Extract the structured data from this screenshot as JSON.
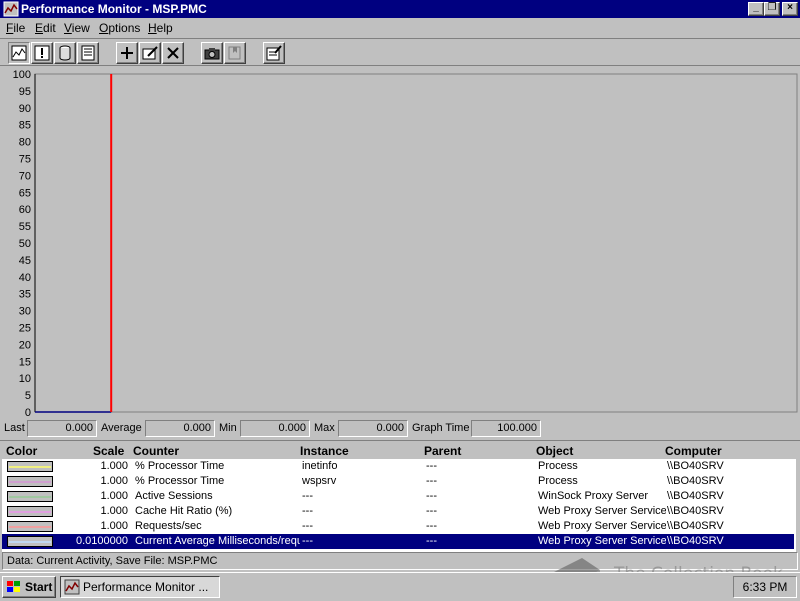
{
  "window": {
    "title": "Performance Monitor - MSP.PMC"
  },
  "menu": [
    {
      "label": "File",
      "key": "F",
      "rest": "ile"
    },
    {
      "label": "Edit",
      "key": "E",
      "rest": "dit"
    },
    {
      "label": "View",
      "key": "V",
      "rest": "iew"
    },
    {
      "label": "Options",
      "key": "O",
      "rest": "ptions"
    },
    {
      "label": "Help",
      "key": "H",
      "rest": "elp"
    }
  ],
  "toolbar": [
    "chart-view-icon",
    "alert-view-icon",
    "log-view-icon",
    "report-view-icon",
    "add-counter-icon",
    "edit-counter-icon",
    "delete-counter-icon",
    "snapshot-icon",
    "bookmark-icon",
    "options-icon"
  ],
  "chart_data": {
    "type": "line",
    "ylim": [
      0,
      100
    ],
    "y_ticks": [
      "100",
      "95",
      "90",
      "85",
      "80",
      "75",
      "70",
      "65",
      "60",
      "55",
      "50",
      "45",
      "40",
      "35",
      "30",
      "25",
      "20",
      "15",
      "10",
      "5",
      "0"
    ],
    "time_cursor_position": 0.1,
    "series": [
      {
        "name": "% Processor Time (inetinfo)",
        "color": "#000080",
        "values": [
          0,
          0,
          0,
          0,
          0,
          0,
          0,
          0,
          0,
          0
        ]
      }
    ],
    "cursor_color": "#ff0000"
  },
  "values": {
    "last_label": "Last",
    "last": "0.000",
    "average_label": "Average",
    "average": "0.000",
    "min_label": "Min",
    "min": "0.000",
    "max_label": "Max",
    "max": "0.000",
    "graph_time_label": "Graph Time",
    "graph_time": "100.000"
  },
  "legend": {
    "headers": {
      "color": "Color",
      "scale": "Scale",
      "counter": "Counter",
      "instance": "Instance",
      "parent": "Parent",
      "object": "Object",
      "computer": "Computer"
    },
    "rows": [
      {
        "color": "#f0f080",
        "scale": "1.000",
        "counter": "% Processor Time",
        "instance": "inetinfo",
        "parent": "---",
        "object": "Process",
        "computer": "\\\\BO40SRV"
      },
      {
        "color": "#d0a0d0",
        "scale": "1.000",
        "counter": "% Processor Time",
        "instance": "wspsrv",
        "parent": "---",
        "object": "Process",
        "computer": "\\\\BO40SRV"
      },
      {
        "color": "#a0c8a0",
        "scale": "1.000",
        "counter": "Active Sessions",
        "instance": "---",
        "parent": "---",
        "object": "WinSock Proxy Server",
        "computer": "\\\\BO40SRV"
      },
      {
        "color": "#e0a0e0",
        "scale": "1.000",
        "counter": "Cache Hit Ratio (%)",
        "instance": "---",
        "parent": "---",
        "object": "Web Proxy Server Service",
        "computer": "\\\\BO40SRV"
      },
      {
        "color": "#f0a0a0",
        "scale": "1.000",
        "counter": "Requests/sec",
        "instance": "---",
        "parent": "---",
        "object": "Web Proxy Server Service",
        "computer": "\\\\BO40SRV"
      },
      {
        "color": "#c0d8f0",
        "scale": "0.0100000",
        "counter": "Current Average Milliseconds/requ",
        "instance": "---",
        "parent": "---",
        "object": "Web Proxy Server Service",
        "computer": "\\\\BO40SRV",
        "selected": true
      }
    ]
  },
  "status": "Data: Current Activity, Save File: MSP.PMC",
  "taskbar": {
    "start": "Start",
    "task": "Performance Monitor ...",
    "clock": "6:33 PM"
  },
  "watermark": "The Collection Book"
}
